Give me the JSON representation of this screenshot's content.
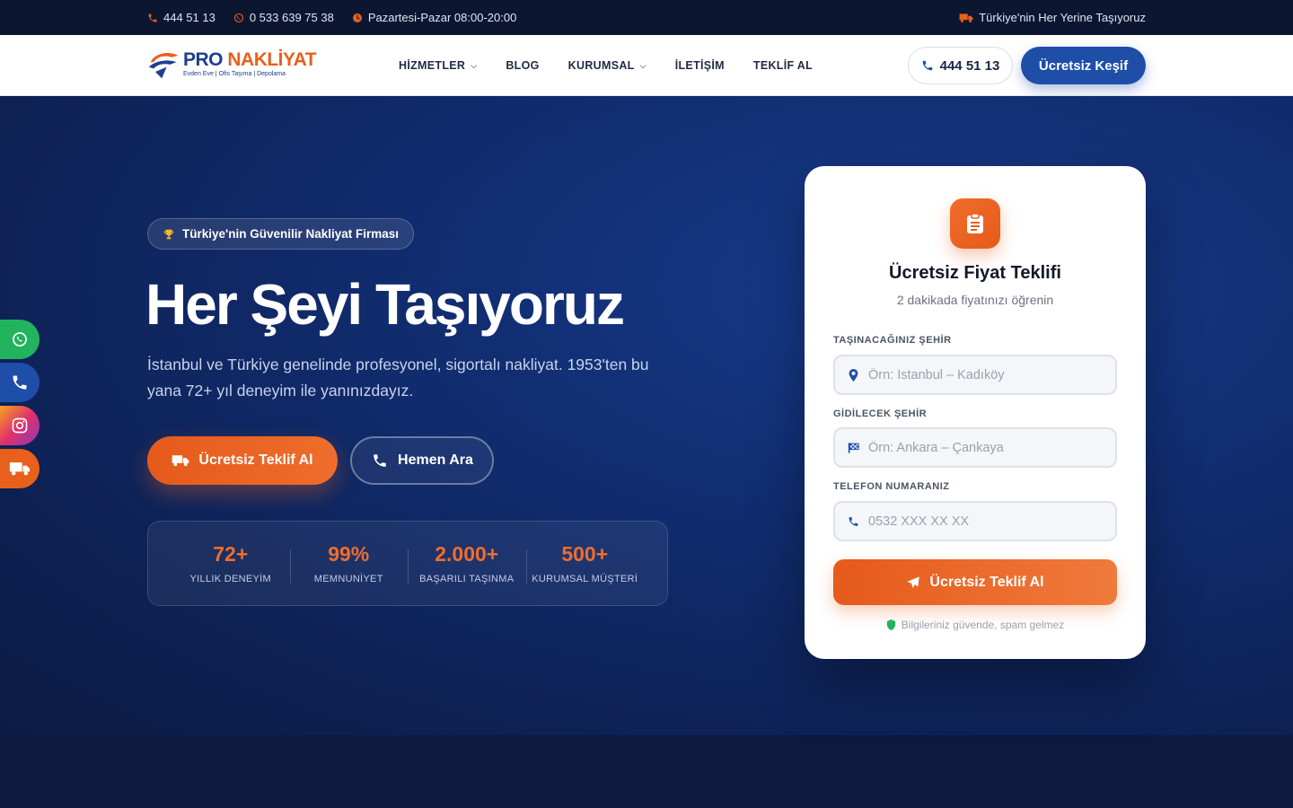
{
  "topbar": {
    "phone1": "444 51 13",
    "phone2": "0 533 639 75 38",
    "hours": "Pazartesi-Pazar 08:00-20:00",
    "tagline": "Türkiye'nin Her Yerine Taşıyoruz"
  },
  "header": {
    "logo_pro": "PRO",
    "logo_nakliyat": "NAKLİYAT",
    "logo_sub": "Evden Eve | Ofis Taşıma | Depolama",
    "nav": {
      "hizmetler": "HİZMETLER",
      "blog": "BLOG",
      "kurumsal": "KURUMSAL",
      "iletisim": "İLETİŞİM",
      "teklif": "TEKLİF AL"
    },
    "phone": "444 51 13",
    "cta": "Ücretsiz Keşif"
  },
  "hero": {
    "badge": "Türkiye'nin Güvenilir Nakliyat Firması",
    "title": "Her Şeyi Taşıyoruz",
    "description": "İstanbul ve Türkiye genelinde profesyonel, sigortalı nakliyat. 1953'ten bu yana 72+ yıl deneyim ile yanınızdayız.",
    "primary_button": "Ücretsiz Teklif Al",
    "secondary_button": "Hemen Ara",
    "stats": [
      {
        "value": "72+",
        "label": "YILLIK DENEYİM"
      },
      {
        "value": "99%",
        "label": "MEMNUNİYET"
      },
      {
        "value": "2.000+",
        "label": "BAŞARILI TAŞINMA"
      },
      {
        "value": "500+",
        "label": "KURUMSAL MÜŞTERİ"
      }
    ]
  },
  "form": {
    "title": "Ücretsiz Fiyat Teklifi",
    "subtitle": "2 dakikada fiyatınızı öğrenin",
    "from_label": "TAŞINACAĞINIZ ŞEHİR",
    "from_placeholder": "Örn: İstanbul – Kadıköy",
    "to_label": "GİDİLECEK ŞEHİR",
    "to_placeholder": "Örn: Ankara – Çankaya",
    "phone_label": "TELEFON NUMARANIZ",
    "phone_placeholder": "0532 XXX XX XX",
    "submit": "Ücretsiz Teklif Al",
    "note": "Bilgileriniz güvende, spam gelmez"
  },
  "colors": {
    "accent": "#e8601c",
    "brand": "#1e4ea8",
    "hero_bg": "#112c6e",
    "whatsapp": "#22b35e"
  },
  "icons": {
    "side": [
      "whatsapp-icon",
      "phone-icon",
      "instagram-icon",
      "truck-icon"
    ]
  }
}
